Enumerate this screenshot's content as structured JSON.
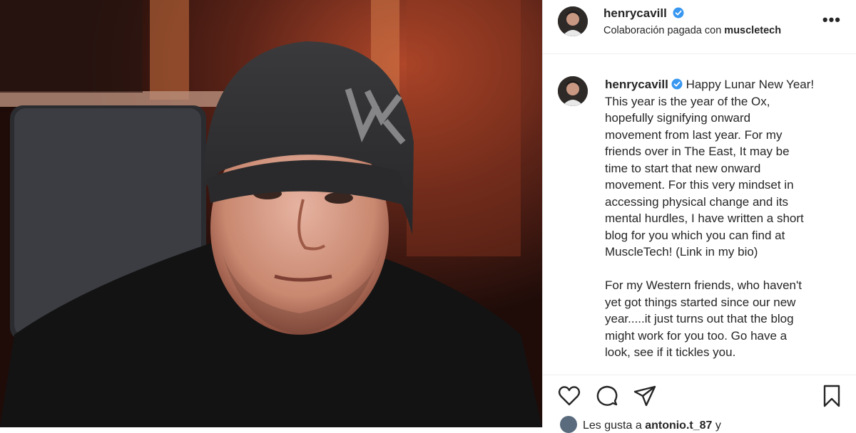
{
  "post": {
    "username": "henrycavill",
    "verified": true,
    "paid_partnership_prefix": "Colaboración pagada con",
    "partner": "muscletech",
    "more_icon": "•••",
    "caption_lines": [
      "Happy Lunar New Year!",
      "This year is the year of the Ox,",
      "hopefully signifying onward",
      "movement from last year. For my",
      "friends over in The East, It may be",
      "time to start that new onward",
      "movement. For this very mindset in",
      "accessing physical change and its",
      "mental hurdles, I have written a short",
      "blog for you which you can find at",
      "MuscleTech! (Link in my bio)",
      "",
      "For my Western friends, who haven't",
      "yet got things started since our new",
      "year.....it just turns out that the blog",
      "might work for you too. Go have a",
      "look, see if it tickles you."
    ],
    "likes_prefix": "Les gusta a",
    "likes_user": "antonio.t_87",
    "likes_suffix": "y"
  },
  "icons": {
    "like": "heart-icon",
    "comment": "comment-icon",
    "share": "send-icon",
    "save": "bookmark-icon",
    "verified": "verified-badge-icon"
  },
  "colors": {
    "verified": "#3897f0",
    "text": "#262626",
    "border": "#dbdbdb"
  }
}
